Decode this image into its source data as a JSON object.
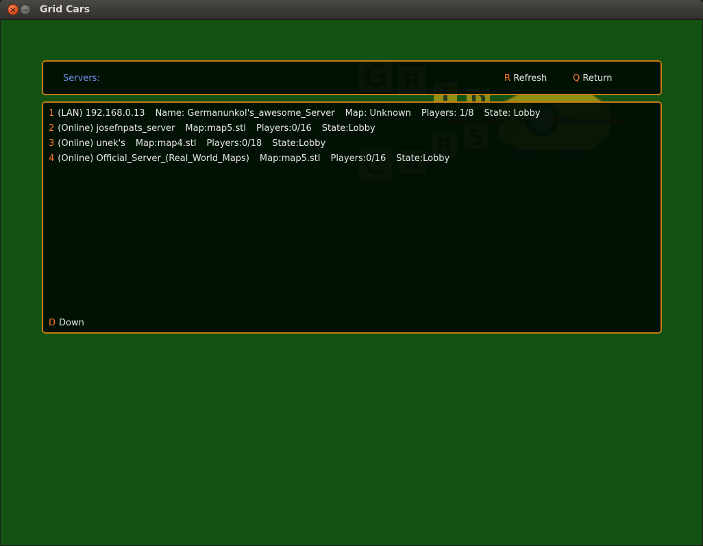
{
  "window": {
    "title": "Grid Cars",
    "close_glyph": "×",
    "min_glyph": "−"
  },
  "header": {
    "servers_label": "Servers:",
    "refresh_key": "R",
    "refresh_label": "Refresh",
    "return_key": "Q",
    "return_label": "Return"
  },
  "servers": [
    {
      "num": "1",
      "fields": [
        "(LAN) 192.168.0.13",
        "Name: Germanunkol's_awesome_Server",
        "Map: Unknown",
        "Players: 1/8",
        "State: Lobby"
      ]
    },
    {
      "num": "2",
      "fields": [
        "(Online) josefnpats_server",
        "Map:map5.stl",
        "Players:0/16",
        "State:Lobby"
      ]
    },
    {
      "num": "3",
      "fields": [
        "(Online) unek's",
        "Map:map4.stl",
        "Players:0/18",
        "State:Lobby"
      ]
    },
    {
      "num": "4",
      "fields": [
        "(Online) Official_Server_(Real_World_Maps)",
        "Map:map5.stl",
        "Players:0/16",
        "State:Lobby"
      ]
    }
  ],
  "footer": {
    "down_key": "D",
    "down_label": "Down"
  },
  "logo": {
    "letters": [
      "G",
      "R",
      "I",
      "D",
      "C",
      "A",
      "R",
      "S"
    ]
  },
  "colors": {
    "background": "#145214",
    "panel_border": "#c57b15",
    "key_highlight": "#ff7b2e",
    "servers_label": "#6f8fe0",
    "text": "#e8e8e8"
  }
}
